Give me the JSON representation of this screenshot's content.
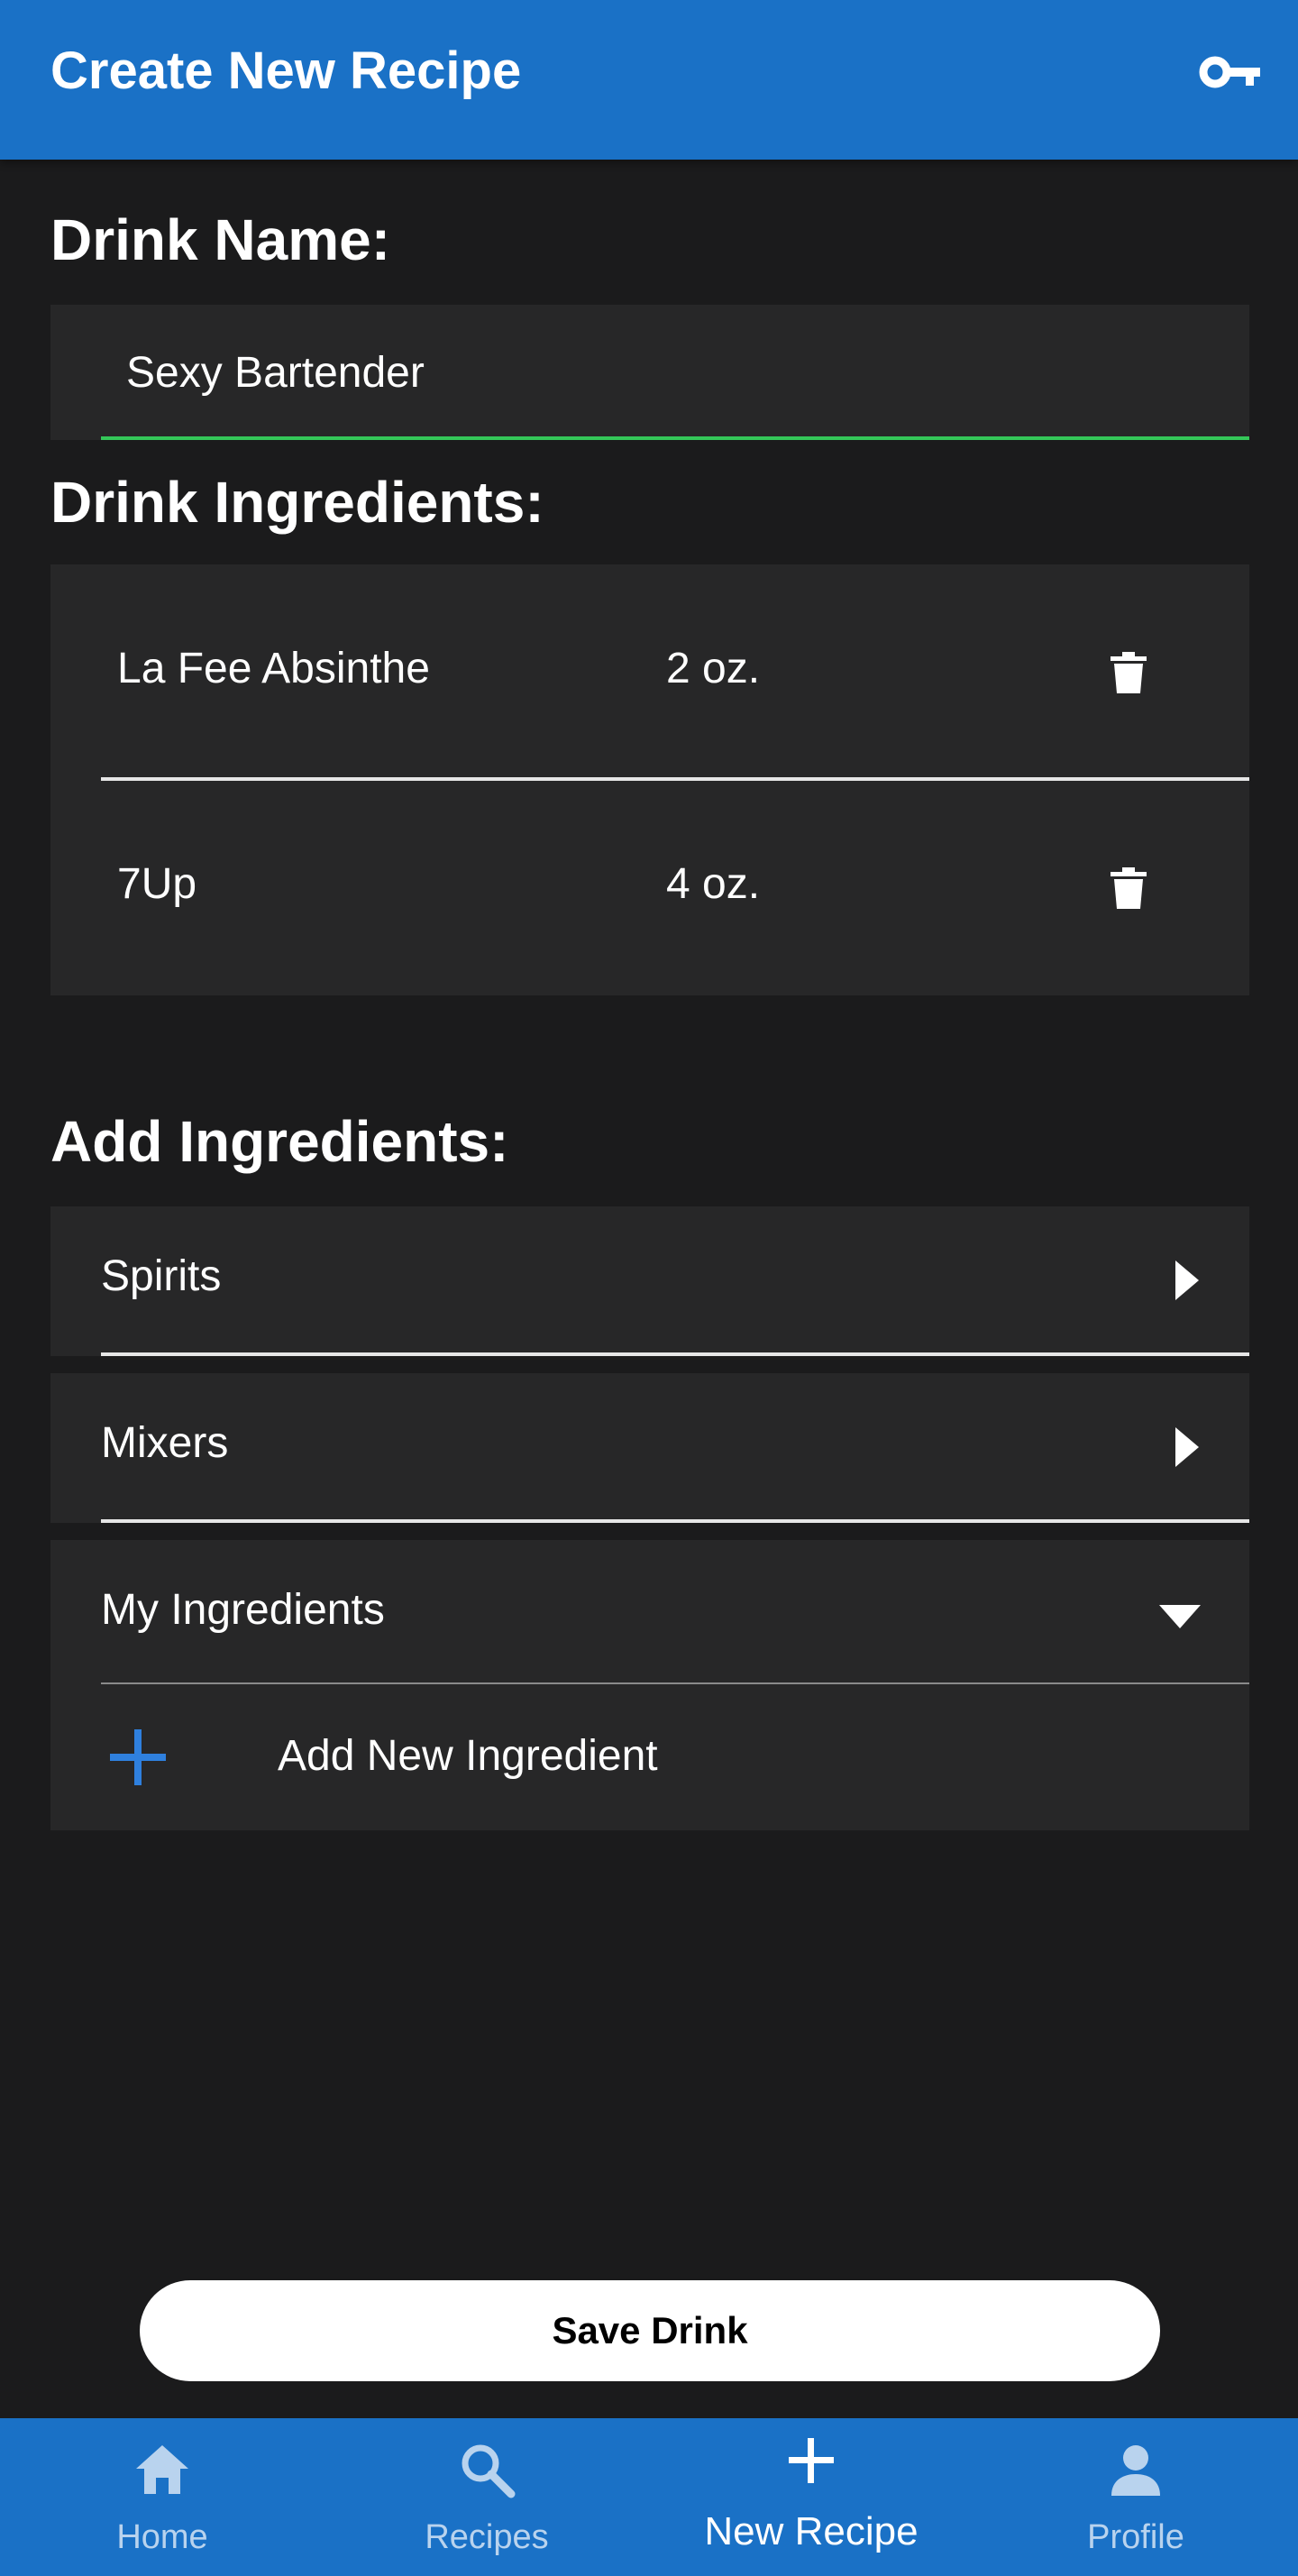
{
  "app_bar": {
    "title": "Create New Recipe",
    "key_icon": "key-icon"
  },
  "drink_name": {
    "heading": "Drink Name:",
    "value": "Sexy Bartender",
    "underline_color": "#34c759"
  },
  "drink_ingredients": {
    "heading": "Drink Ingredients:",
    "items": [
      {
        "name": "La Fee Absinthe",
        "amount": "2 oz.",
        "icon": "trash-icon"
      },
      {
        "name": "7Up",
        "amount": "4 oz.",
        "icon": "trash-icon"
      }
    ]
  },
  "add_ingredients": {
    "heading": "Add Ingredients:",
    "categories": [
      {
        "label": "Spirits",
        "icon": "caret-right-icon",
        "expanded": false
      },
      {
        "label": "Mixers",
        "icon": "caret-right-icon",
        "expanded": false
      },
      {
        "label": "My Ingredients",
        "icon": "caret-down-icon",
        "expanded": true
      }
    ],
    "add_new_label": "Add New Ingredient",
    "add_new_icon": "plus-icon"
  },
  "save_button": {
    "label": "Save Drink"
  },
  "bottom_nav": {
    "items": [
      {
        "label": "Home",
        "icon": "home-icon",
        "active": false
      },
      {
        "label": "Recipes",
        "icon": "search-icon",
        "active": false
      },
      {
        "label": "New Recipe",
        "icon": "plus-icon",
        "active": true
      },
      {
        "label": "Profile",
        "icon": "person-icon",
        "active": false
      }
    ]
  },
  "colors": {
    "app_bar": "#1a71c6",
    "background": "#1b1b1c",
    "card": "#272728",
    "accent_blue": "#2f80de"
  }
}
